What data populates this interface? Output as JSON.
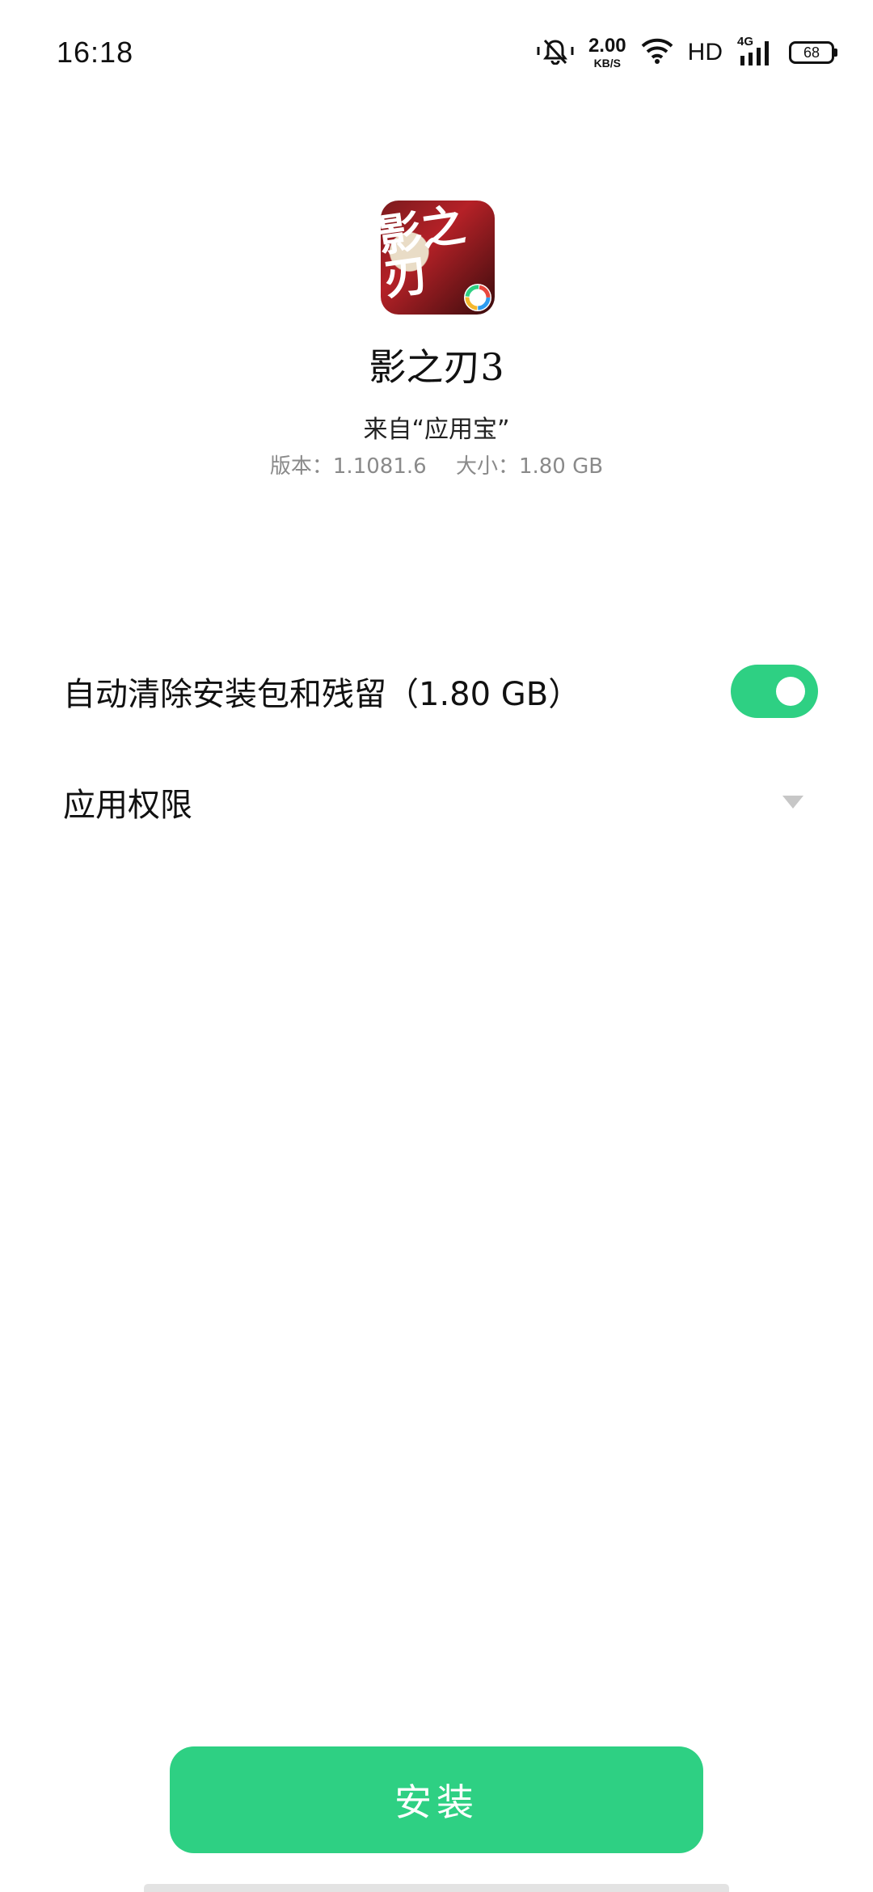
{
  "status_bar": {
    "time": "16:18",
    "net_speed_value": "2.00",
    "net_speed_unit": "KB/S",
    "hd_label": "HD",
    "signal_label": "4G",
    "battery": "68",
    "icons": [
      "mute-icon",
      "wifi-icon",
      "signal-icon",
      "battery-icon"
    ]
  },
  "app": {
    "name": "影之刃3",
    "icon_text": "影之刃",
    "source": "来自“应用宝”",
    "version_text": "版本：1.1081.6",
    "size_text": "大小：1.80 GB"
  },
  "settings": {
    "auto_clean_label": "自动清除安装包和残留（1.80 GB）",
    "auto_clean_enabled": true,
    "permissions_label": "应用权限"
  },
  "install_button": {
    "label": "安装"
  },
  "colors": {
    "accent": "#2ed083",
    "meta_text": "#8a8a8a",
    "chevron": "#c7c7c7"
  }
}
